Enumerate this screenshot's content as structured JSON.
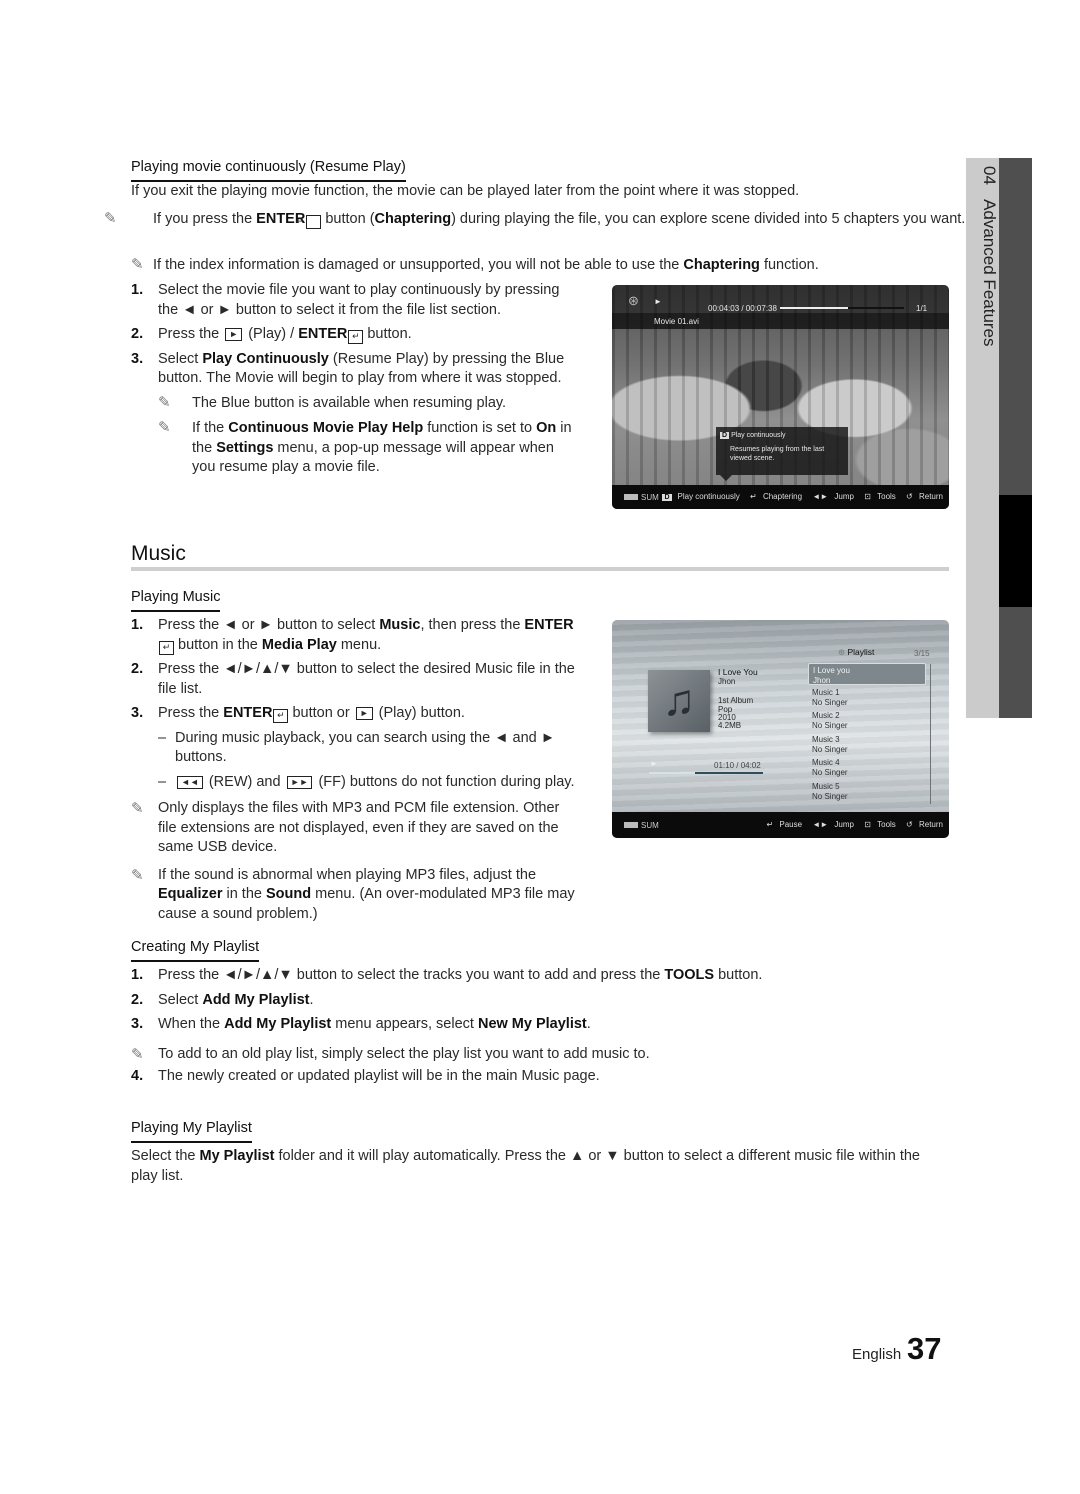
{
  "sidebar": {
    "chapter_number": "04",
    "chapter_title": "Advanced Features"
  },
  "resume": {
    "heading": "Playing movie continuously (Resume Play)",
    "intro": "If you exit the playing movie function, the movie can be played later from the point where it was stopped.",
    "note1": {
      "pre": "If you press the ",
      "enter": "ENTER",
      "mid": " button (",
      "bold": "Chaptering",
      "post": ") during playing the file, you can explore scene divided into 5 chapters you want."
    },
    "note2": {
      "pre": "If the index information is damaged or unsupported, you will not be able to use the ",
      "bold": "Chaptering",
      "post": " function."
    },
    "steps": [
      {
        "num": "1.",
        "text": "Select the movie file you want to play continuously by pressing the ◄ or ► button to select it from the file list section."
      },
      {
        "num": "2.",
        "pre": "Press the ",
        "key": "►",
        "mid": " (Play) / ",
        "enter": "ENTER",
        "post": " button."
      },
      {
        "num": "3.",
        "pre": "Select ",
        "bold": "Play Continuously",
        "post": " (Resume Play) by pressing the Blue button. The Movie will begin to play from where it was stopped."
      }
    ],
    "subnote1": "The Blue button is available when resuming play.",
    "subnote2": {
      "a": "If the ",
      "b1": "Continuous Movie Play Help",
      "c": " function is set to ",
      "b2": "On",
      "d": " in the ",
      "b3": "Settings",
      "e": " menu, a pop-up message will appear when you resume play a movie file."
    }
  },
  "movie_player": {
    "time": "00:04:03 / 00:07:38",
    "progress_fraction": 0.55,
    "page": "1/1",
    "filename": "Movie 01.avi",
    "popup_title": "Play continuously",
    "popup_text": "Resumes playing from the last viewed scene.",
    "badge": "D",
    "device": "SUM",
    "footer": {
      "play_continuously": "Play continuously",
      "chaptering": "Chaptering",
      "jump": "Jump",
      "tools": "Tools",
      "return": "Return"
    }
  },
  "music": {
    "title": "Music",
    "playing_heading": "Playing Music",
    "step1": {
      "pre": "Press the ◄ or ► button to select ",
      "b1": "Music",
      "mid": ", then press the ",
      "enter": "ENTER",
      "mid2": " button in the ",
      "b2": "Media Play",
      "post": " menu."
    },
    "step2": "Press the ◄/►/▲/▼ button to select the desired Music file in the file list.",
    "step3": {
      "pre": "Press the ",
      "enter": "ENTER",
      "mid": " button or ",
      "key": "►",
      "post": " (Play) button."
    },
    "dash1": "During music playback, you can search using the ◄ and ► buttons.",
    "dash2": {
      "rew": "◄◄",
      "a": " (REW) and ",
      "ff": "►►",
      "b": " (FF) buttons do not function during play."
    },
    "note1": "Only displays the files with MP3 and PCM file extension. Other file extensions are not displayed, even if they are saved on the same USB device.",
    "note2": {
      "pre": "If the sound is abnormal when playing MP3 files, adjust the ",
      "b1": "Equalizer",
      "mid": " in the ",
      "b2": "Sound",
      "post": " menu. (An over-modulated MP3 file may cause a sound problem.)"
    }
  },
  "music_player": {
    "playlist_label": "Playlist",
    "count": "3/15",
    "now_title": "I Love You",
    "now_artist": "Jhon",
    "album": "1st Album",
    "genre": "Pop",
    "year": "2010",
    "size": "4.2MB",
    "time": "01:10 / 04:02",
    "progress_fraction": 0.4,
    "playlist": [
      {
        "title": "I Love you",
        "artist": "Jhon",
        "selected": true
      },
      {
        "title": "Music 1",
        "artist": "No Singer"
      },
      {
        "title": "Music 2",
        "artist": "No Singer"
      },
      {
        "title": "Music 3",
        "artist": "No Singer"
      },
      {
        "title": "Music 4",
        "artist": "No Singer"
      },
      {
        "title": "Music 5",
        "artist": "No Singer"
      }
    ],
    "device": "SUM",
    "footer": {
      "pause": "Pause",
      "jump": "Jump",
      "tools": "Tools",
      "return": "Return"
    }
  },
  "creating": {
    "heading": "Creating My Playlist",
    "step1": {
      "pre": "Press the ◄/►/▲/▼ button to select the tracks you want to add and press the ",
      "b": "TOOLS",
      "post": " button."
    },
    "step2": {
      "pre": "Select ",
      "b": "Add My Playlist",
      "post": "."
    },
    "step3": {
      "pre": "When the ",
      "b1": "Add My Playlist",
      "mid": " menu appears, select ",
      "b2": "New My Playlist",
      "post": "."
    },
    "note": "To add to an old play list, simply select the play list you want to add music to.",
    "step4": "The newly created or updated playlist will be in the main Music page."
  },
  "playing_playlist": {
    "heading": "Playing My Playlist",
    "pre": "Select the ",
    "b": "My Playlist",
    "post": " folder and it will play automatically. Press the ▲ or ▼ button to select a different music file within the play list."
  },
  "footer": {
    "language": "English",
    "page_number": "37"
  },
  "icons": {
    "note": "✎",
    "enter": "↵"
  }
}
